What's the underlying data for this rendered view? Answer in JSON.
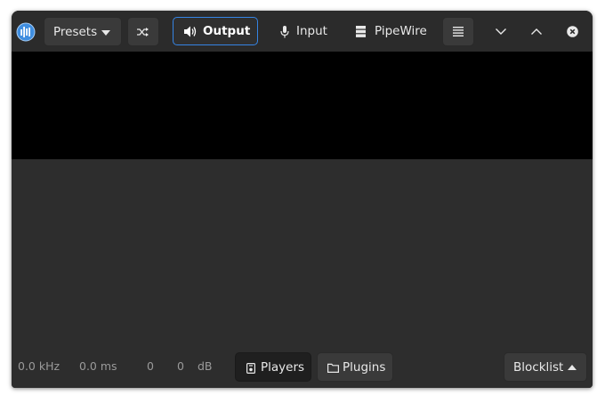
{
  "header": {
    "presets_label": "Presets",
    "tabs": [
      {
        "label": "Output",
        "icon": "speaker-icon",
        "active": true
      },
      {
        "label": "Input",
        "icon": "microphone-icon",
        "active": false
      },
      {
        "label": "PipeWire",
        "icon": "server-icon",
        "active": false
      }
    ]
  },
  "footer": {
    "sample_rate": "0.0 kHz",
    "latency": "0.0 ms",
    "level_left": "0",
    "level_right": "0",
    "level_unit": "dB",
    "players_label": "Players",
    "plugins_label": "Plugins",
    "blocklist_label": "Blocklist"
  },
  "colors": {
    "accent": "#3584e4",
    "window_bg": "#2d2d2d",
    "canvas_bg": "#000000"
  }
}
